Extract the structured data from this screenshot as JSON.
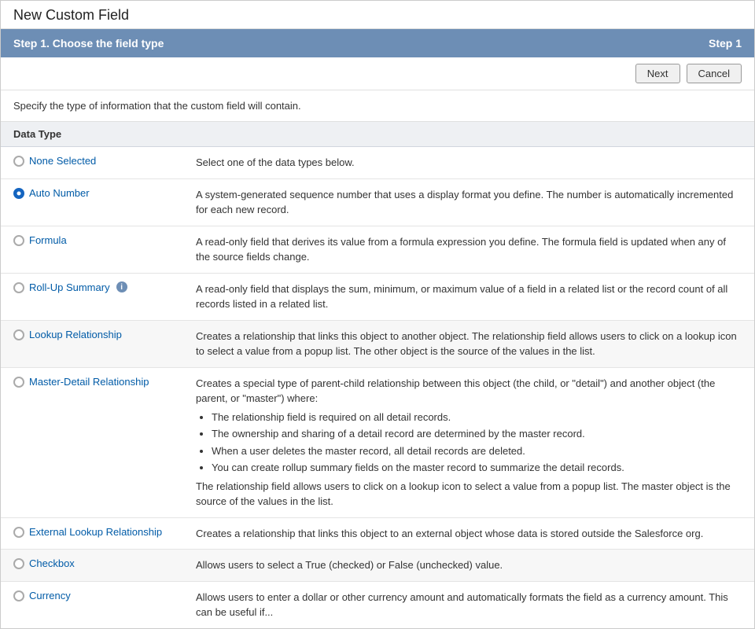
{
  "page": {
    "title": "New Custom Field"
  },
  "step_header": {
    "label": "Step 1. Choose the field type",
    "step_indicator": "Step 1"
  },
  "buttons": {
    "next": "Next",
    "cancel": "Cancel"
  },
  "description": "Specify the type of information that the custom field will contain.",
  "data_type_header": "Data Type",
  "field_types": [
    {
      "id": "none-selected",
      "label": "None Selected",
      "selected": false,
      "description": "Select one of the data types below.",
      "has_info": false
    },
    {
      "id": "auto-number",
      "label": "Auto Number",
      "selected": true,
      "description": "A system-generated sequence number that uses a display format you define. The number is automatically incremented for each new record.",
      "has_info": false
    },
    {
      "id": "formula",
      "label": "Formula",
      "selected": false,
      "description": "A read-only field that derives its value from a formula expression you define. The formula field is updated when any of the source fields change.",
      "has_info": false
    },
    {
      "id": "roll-up-summary",
      "label": "Roll-Up Summary",
      "selected": false,
      "description": "A read-only field that displays the sum, minimum, or maximum value of a field in a related list or the record count of all records listed in a related list.",
      "has_info": true
    },
    {
      "id": "lookup-relationship",
      "label": "Lookup Relationship",
      "selected": false,
      "description": "Creates a relationship that links this object to another object. The relationship field allows users to click on a lookup icon to select a value from a popup list. The other object is the source of the values in the list.",
      "has_info": false,
      "group_start": true
    },
    {
      "id": "master-detail-relationship",
      "label": "Master-Detail Relationship",
      "selected": false,
      "description": "Creates a special type of parent-child relationship between this object (the child, or \"detail\") and another object (the parent, or \"master\") where:",
      "has_info": false,
      "bullets": [
        "The relationship field is required on all detail records.",
        "The ownership and sharing of a detail record are determined by the master record.",
        "When a user deletes the master record, all detail records are deleted.",
        "You can create rollup summary fields on the master record to summarize the detail records."
      ],
      "extra_desc": "The relationship field allows users to click on a lookup icon to select a value from a popup list. The master object is the source of the values in the list."
    },
    {
      "id": "external-lookup-relationship",
      "label": "External Lookup Relationship",
      "selected": false,
      "description": "Creates a relationship that links this object to an external object whose data is stored outside the Salesforce org.",
      "has_info": false
    },
    {
      "id": "checkbox",
      "label": "Checkbox",
      "selected": false,
      "description": "Allows users to select a True (checked) or False (unchecked) value.",
      "has_info": false,
      "group_start": true
    },
    {
      "id": "currency",
      "label": "Currency",
      "selected": false,
      "description": "Allows users to enter a dollar or other currency amount and automatically formats the field as a currency amount. This can be useful if...",
      "has_info": false
    }
  ]
}
